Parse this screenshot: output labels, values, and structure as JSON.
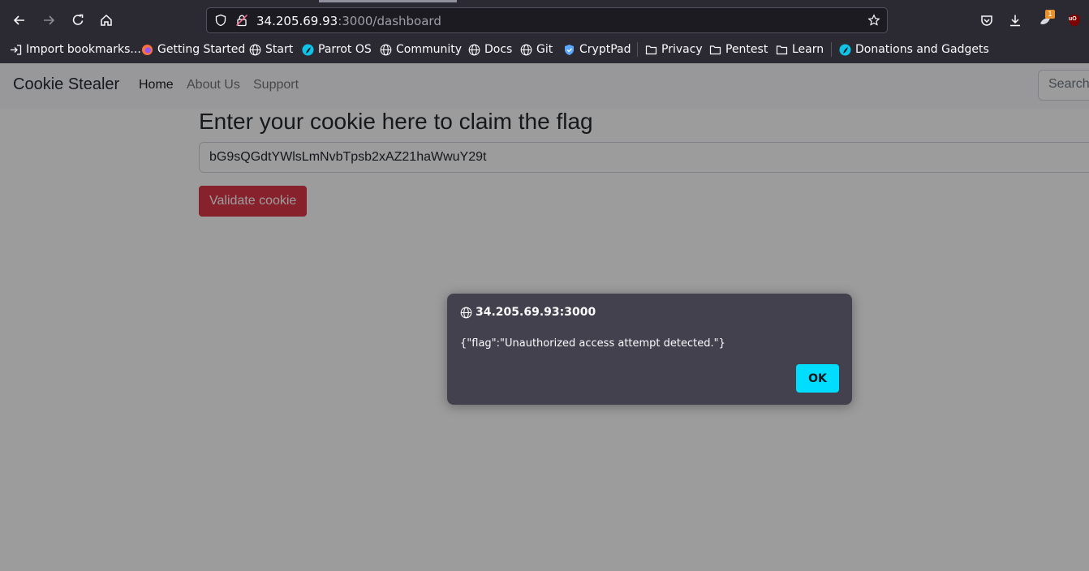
{
  "browser": {
    "url": {
      "host": "34.205.69.93",
      "path": ":3000/dashboard"
    },
    "download_badge": "1",
    "ublock_label": "uO",
    "bookmarks": [
      {
        "label": "Import bookmarks...",
        "icon": "import-icon"
      },
      {
        "label": "Getting Started",
        "icon": "firefox-icon"
      },
      {
        "label": "Start",
        "icon": "globe-icon"
      },
      {
        "label": "Parrot OS",
        "icon": "parrot-icon"
      },
      {
        "label": "Community",
        "icon": "globe-icon"
      },
      {
        "label": "Docs",
        "icon": "globe-icon"
      },
      {
        "label": "Git",
        "icon": "globe-icon"
      },
      {
        "label": "CryptPad",
        "icon": "shield-icon"
      },
      {
        "label": "Privacy",
        "icon": "folder-icon"
      },
      {
        "label": "Pentest",
        "icon": "folder-icon"
      },
      {
        "label": "Learn",
        "icon": "folder-icon"
      },
      {
        "label": "Donations and Gadgets",
        "icon": "parrot-icon"
      }
    ]
  },
  "navbar": {
    "brand": "Cookie Stealer",
    "links": [
      "Home",
      "About Us",
      "Support"
    ],
    "search_placeholder": "Search"
  },
  "main": {
    "heading": "Enter your cookie here to claim the flag",
    "cookie_value": "bG9sQGdtYWlsLmNvbTpsb2xAZ21haWwuY29t",
    "validate_label": "Validate cookie"
  },
  "dialog": {
    "origin": "34.205.69.93:3000",
    "message": "{\"flag\":\"Unauthorized access attempt detected.\"}",
    "ok_label": "OK"
  },
  "colors": {
    "chrome_bg": "#2b2a33",
    "dialog_bg": "#42414d",
    "ok_button": "#00ddff",
    "validate_button": "#dc3545"
  }
}
